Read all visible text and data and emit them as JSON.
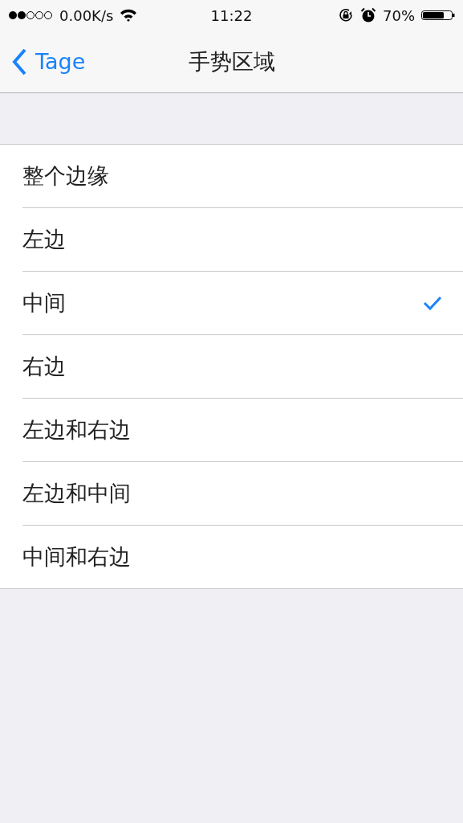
{
  "status_bar": {
    "network_speed": "0.00K/s",
    "time": "11:22",
    "battery_percent": "70%"
  },
  "nav_bar": {
    "back_label": "Tage",
    "title": "手势区域"
  },
  "options": [
    {
      "label": "整个边缘",
      "selected": false
    },
    {
      "label": "左边",
      "selected": false
    },
    {
      "label": "中间",
      "selected": true
    },
    {
      "label": "右边",
      "selected": false
    },
    {
      "label": "左边和右边",
      "selected": false
    },
    {
      "label": "左边和中间",
      "selected": false
    },
    {
      "label": "中间和右边",
      "selected": false
    }
  ]
}
